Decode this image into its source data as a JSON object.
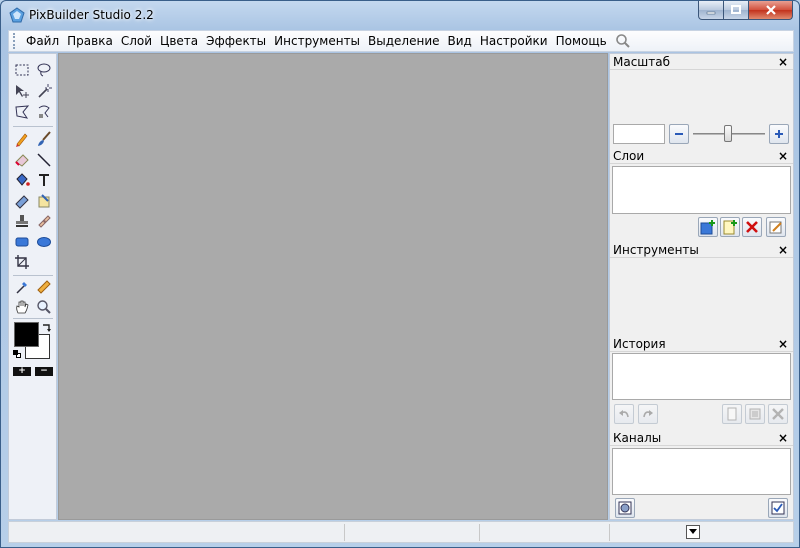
{
  "window": {
    "title": "PixBuilder Studio 2.2"
  },
  "menu": [
    "Файл",
    "Правка",
    "Слой",
    "Цвета",
    "Эффекты",
    "Инструменты",
    "Выделение",
    "Вид",
    "Настройки",
    "Помощь"
  ],
  "tools": [
    "rect-select-icon",
    "lasso-icon",
    "move-icon",
    "magic-wand-icon",
    "poly-lasso-icon",
    "magnetic-lasso-icon",
    "pencil-icon",
    "brush-icon",
    "eraser-icon",
    "line-icon",
    "paint-bucket-icon",
    "text-icon",
    "gradient-icon",
    "smudge-icon",
    "clone-stamp-icon",
    "heal-icon",
    "rounded-rect-icon",
    "ellipse-icon",
    "crop-icon",
    "eyedropper-icon",
    "measure-icon",
    "hand-icon",
    "zoom-icon"
  ],
  "colors": {
    "foreground": "#000000",
    "background": "#ffffff"
  },
  "panels": {
    "zoom": {
      "title": "Масштаб",
      "value": ""
    },
    "layers": {
      "title": "Слои"
    },
    "tools": {
      "title": "Инструменты"
    },
    "history": {
      "title": "История"
    },
    "channels": {
      "title": "Каналы"
    }
  },
  "close_glyph": "×",
  "plus_glyph": "+",
  "minus_glyph": "−"
}
